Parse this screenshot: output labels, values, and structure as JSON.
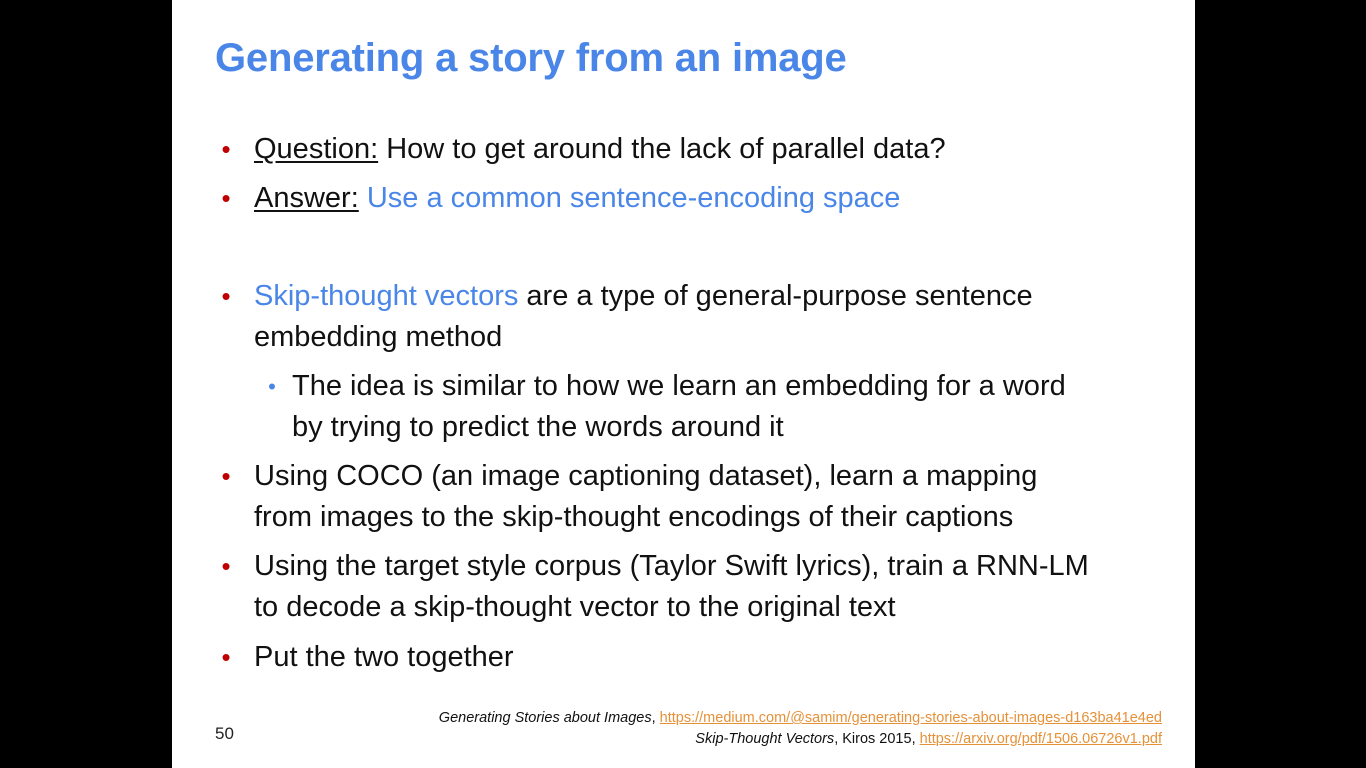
{
  "slide": {
    "title": "Generating a story from an image",
    "page_number": "50",
    "bullets": [
      {
        "label": "Question:",
        "text": " How to get around the lack of parallel data?"
      },
      {
        "label": "Answer:",
        "text": " ",
        "highlight": "Use a common sentence-encoding space"
      },
      {
        "highlight": "Skip-thought vectors",
        "text": " are a type of general-purpose sentence",
        "text2": "embedding method"
      },
      {
        "text": "The idea is similar to how we learn an embedding for a word",
        "text2": "by trying to predict the words around it"
      },
      {
        "text": "Using COCO (an image captioning dataset), learn a mapping",
        "text2": "from images to the skip-thought encodings of their captions"
      },
      {
        "text": "Using the target style corpus (Taylor Swift lyrics), train a RNN-LM",
        "text2": "to decode a skip-thought vector to the original text"
      },
      {
        "text": "Put the two together"
      }
    ],
    "references": [
      {
        "title": "Generating Stories about Images",
        "sep": ", ",
        "url": "https://medium.com/@samim/generating-stories-about-images-d163ba41e4ed"
      },
      {
        "title": "Skip-Thought Vectors",
        "sep": ", Kiros 2015, ",
        "url": "https://arxiv.org/pdf/1506.06726v1.pdf"
      }
    ],
    "colors": {
      "title": "#4a86e8",
      "highlight": "#4a86e8",
      "bullet": "#c00000",
      "sub_bullet": "#4a86e8",
      "link": "#e69138"
    }
  }
}
